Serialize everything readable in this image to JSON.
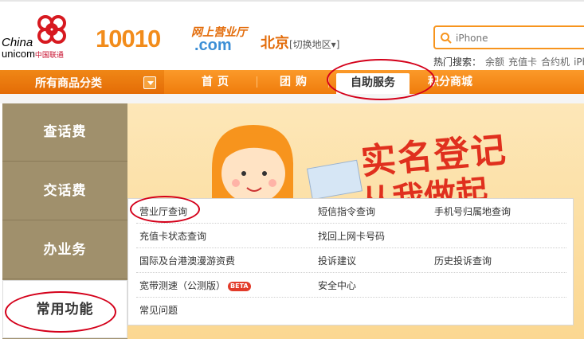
{
  "header": {
    "logo_line1": "China",
    "logo_line2": "unicom",
    "logo_cn": "中国联通",
    "brand_number": "10010",
    "brand_sub": "网上营业厅",
    "brand_domain": ".com",
    "city": "北京",
    "city_switch": "[切换地区▾]",
    "search_placeholder": "iPhone",
    "hot_label": "热门搜索：",
    "hot_keywords": [
      "余额",
      "充值卡",
      "合约机",
      "iPh"
    ]
  },
  "nav": {
    "category": "所有商品分类",
    "items": [
      "首页",
      "团购",
      "自助服务",
      "积分商城"
    ],
    "active_index": 2
  },
  "left_menu": {
    "items": [
      "查话费",
      "交话费",
      "办业务",
      "常用功能"
    ],
    "active_index": 3
  },
  "banner": {
    "title": "实名登记",
    "subtitle": "从我做起"
  },
  "dropdown": {
    "rows": [
      [
        "营业厅查询",
        "短信指令查询",
        "手机号归属地查询"
      ],
      [
        "充值卡状态查询",
        "找回上网卡号码",
        ""
      ],
      [
        "国际及台港澳漫游资费",
        "投诉建议",
        "历史投诉查询"
      ],
      [
        "宽带测速（公测版）",
        "安全中心",
        ""
      ],
      [
        "常见问题",
        "",
        ""
      ]
    ],
    "beta_label": "BETA"
  },
  "colors": {
    "orange": "#f7941d",
    "brand_orange": "#f28c1b",
    "red": "#d4001a",
    "left_bg": "#a0906c"
  }
}
